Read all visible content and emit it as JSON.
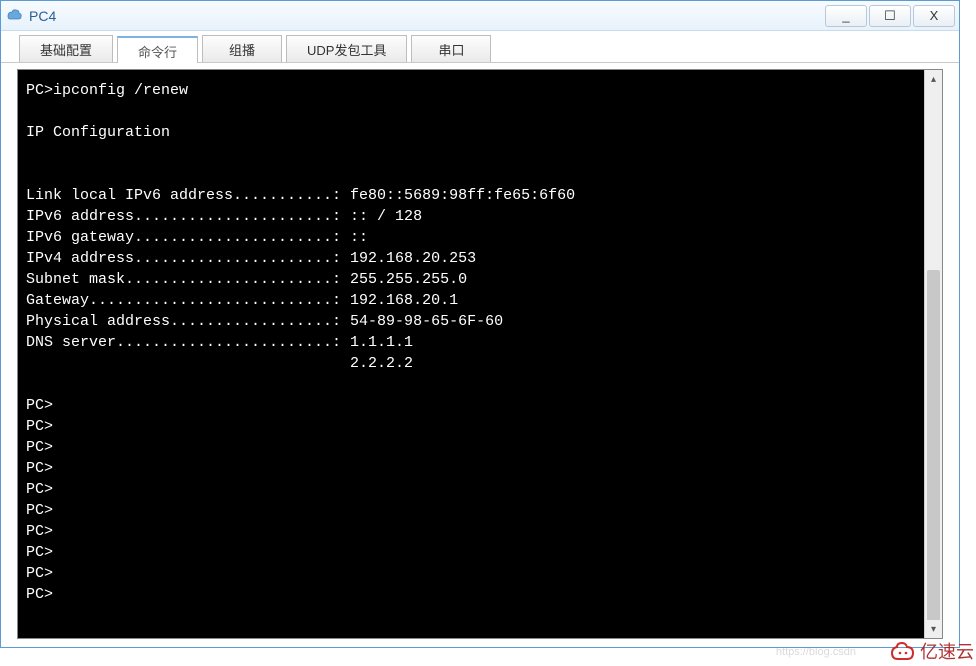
{
  "window": {
    "title": "PC4"
  },
  "tabs": [
    {
      "label": "基础配置"
    },
    {
      "label": "命令行"
    },
    {
      "label": "组播"
    },
    {
      "label": "UDP发包工具"
    },
    {
      "label": "串口"
    }
  ],
  "terminal": {
    "prompt": "PC>",
    "command": "ipconfig /renew",
    "header": "IP Configuration",
    "lines": [
      "Link local IPv6 address...........: fe80::5689:98ff:fe65:6f60",
      "IPv6 address......................: :: / 128",
      "IPv6 gateway......................: ::",
      "IPv4 address......................: 192.168.20.253",
      "Subnet mask.......................: 255.255.255.0",
      "Gateway...........................: 192.168.20.1",
      "Physical address..................: 54-89-98-65-6F-60",
      "DNS server........................: 1.1.1.1",
      "                                    2.2.2.2"
    ],
    "empty_prompts": 10
  },
  "watermark": {
    "text": "亿速云",
    "blog": "https://blog.csdn"
  },
  "win_controls": {
    "minimize": "_",
    "maximize": "☐",
    "close": "X"
  }
}
